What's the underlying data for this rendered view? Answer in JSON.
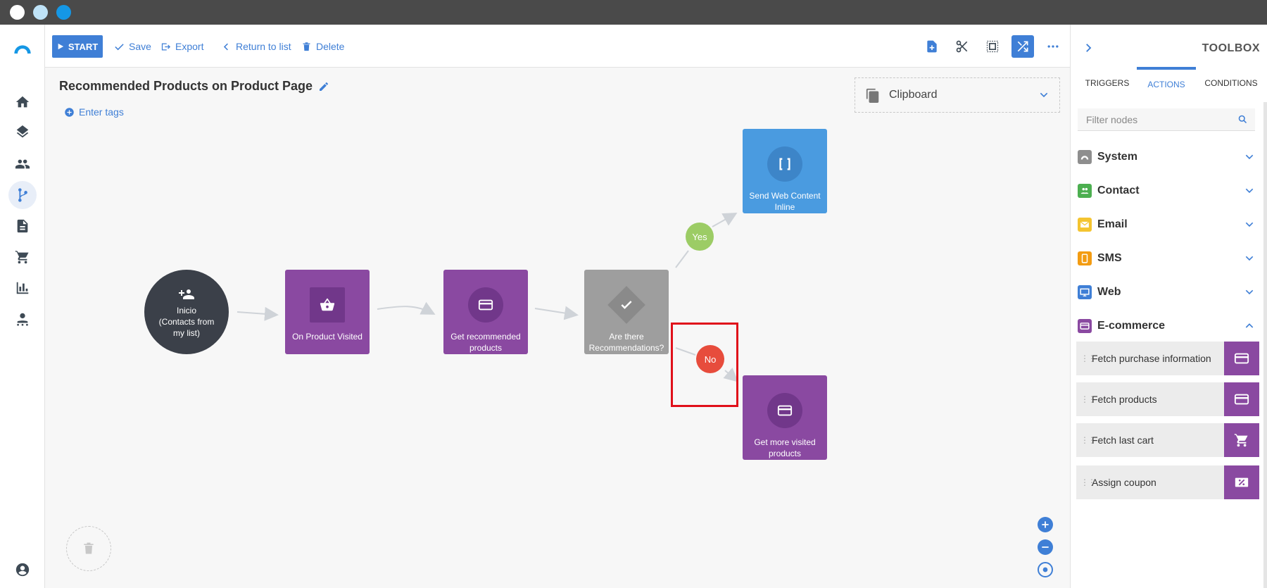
{
  "colors": {
    "accent": "#3f7fd6",
    "purple": "#8a49a1",
    "gray_node": "#9e9e9e",
    "blue_node": "#4a9be0",
    "dark_node": "#3b4049",
    "yes": "#9ccc65",
    "no": "#e74c3c",
    "highlight": "#e0101a"
  },
  "toolbar": {
    "start_label": "START",
    "save_label": "Save",
    "export_label": "Export",
    "return_label": "Return to list",
    "delete_label": "Delete"
  },
  "page": {
    "title": "Recommended Products on Product Page",
    "tags_label": "Enter tags"
  },
  "clipboard": {
    "label": "Clipboard"
  },
  "flow": {
    "start_node": {
      "line1": "Inicio",
      "line2": "(Contacts from my list)"
    },
    "on_product_visited": "On Product Visited",
    "get_recommended": "Get recommended products",
    "are_there": "Are there Recommendations?",
    "send_web_content": "Send Web Content Inline",
    "get_more_visited": "Get more visited products",
    "yes_label": "Yes",
    "no_label": "No"
  },
  "toolbox": {
    "title": "TOOLBOX",
    "tabs": [
      "TRIGGERS",
      "ACTIONS",
      "CONDITIONS"
    ],
    "filter_placeholder": "Filter nodes",
    "categories": [
      "System",
      "Contact",
      "Email",
      "SMS",
      "Web",
      "E-commerce"
    ],
    "ecommerce_actions": [
      "Fetch purchase information",
      "Fetch products",
      "Fetch last cart",
      "Assign coupon"
    ]
  },
  "icons": {
    "nav": [
      "home-icon",
      "layers-icon",
      "people-icon",
      "flow-icon",
      "document-icon",
      "cart-icon",
      "chart-icon",
      "user-support-icon",
      "account-icon"
    ]
  }
}
